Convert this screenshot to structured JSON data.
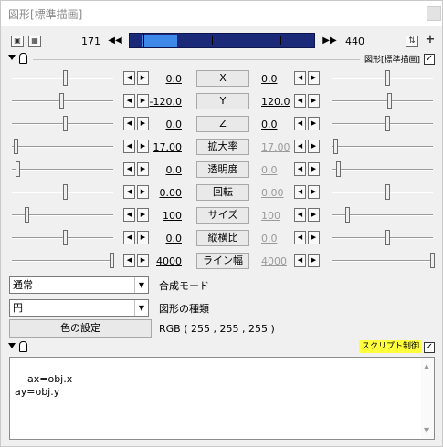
{
  "window": {
    "title": "図形[標準描画]"
  },
  "toolbar": {
    "icons": [
      "film-icon",
      "image-icon"
    ],
    "frame_start": "171",
    "frame_end": "440",
    "prev_label": "◀◀",
    "next_label": "▶▶",
    "swap_icon": "swap-icon",
    "add_icon": "plus-icon",
    "add_label": "+",
    "swap_label": "⇅"
  },
  "panels": [
    {
      "label": "図形[標準描画]",
      "checked": true
    },
    {
      "label": "スクリプト制御",
      "checked": true
    }
  ],
  "check_mark": "✓",
  "arrow_left": "◀",
  "arrow_right": "▶",
  "params": [
    {
      "name": "X",
      "left": "0.0",
      "right": "0.0",
      "right_active": true
    },
    {
      "name": "Y",
      "left": "-120.0",
      "right": "120.0",
      "right_active": true
    },
    {
      "name": "Z",
      "left": "0.0",
      "right": "0.0",
      "right_active": true
    },
    {
      "name": "拡大率",
      "left": "17.00",
      "right": "17.00",
      "right_active": false
    },
    {
      "name": "透明度",
      "left": "0.0",
      "right": "0.0",
      "right_active": false
    },
    {
      "name": "回転",
      "left": "0.00",
      "right": "0.00",
      "right_active": false
    },
    {
      "name": "サイズ",
      "left": "100",
      "right": "100",
      "right_active": false
    },
    {
      "name": "縦横比",
      "left": "0.0",
      "right": "0.0",
      "right_active": false
    },
    {
      "name": "ライン幅",
      "left": "4000",
      "right": "4000",
      "right_active": false
    }
  ],
  "blend": {
    "value": "通常",
    "label": "合成モード"
  },
  "shape": {
    "value": "円",
    "label": "図形の種類"
  },
  "color": {
    "button": "色の設定",
    "value": "RGB ( 255 , 255 , 255 )"
  },
  "script": {
    "text": "ax=obj.x\nay=obj.y"
  },
  "scroll": {
    "up": "▲",
    "down": "▼"
  },
  "dropdown_arrow": "▼"
}
